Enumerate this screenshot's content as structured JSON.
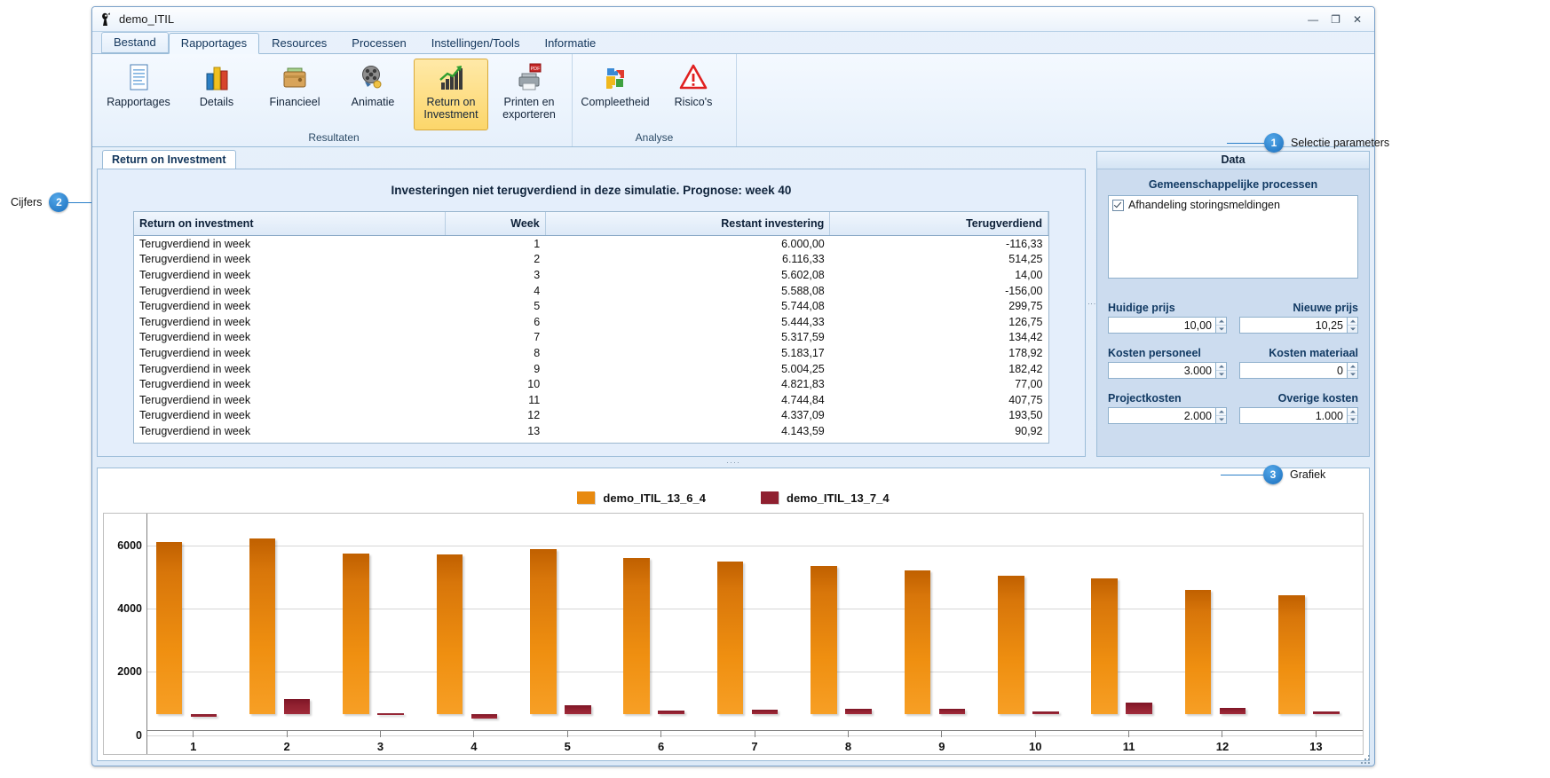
{
  "window": {
    "title": "demo_ITIL",
    "icon": "app-icon",
    "buttons": {
      "minimize": "—",
      "maximize": "❐",
      "close": "✕"
    }
  },
  "ribbon": {
    "tabs": [
      {
        "label": "Bestand",
        "active": false
      },
      {
        "label": "Rapportages",
        "active": true
      },
      {
        "label": "Resources",
        "active": false
      },
      {
        "label": "Processen",
        "active": false
      },
      {
        "label": "Instellingen/Tools",
        "active": false
      },
      {
        "label": "Informatie",
        "active": false
      }
    ],
    "groups": [
      {
        "caption": "Resultaten",
        "items": [
          {
            "label": "Rapportages",
            "icon": "document-icon",
            "selected": false
          },
          {
            "label": "Details",
            "icon": "bar-chart-icon",
            "selected": false
          },
          {
            "label": "Financieel",
            "icon": "wallet-icon",
            "selected": false
          },
          {
            "label": "Animatie",
            "icon": "film-reel-icon",
            "selected": false
          },
          {
            "label": "Return on Investment",
            "icon": "growth-chart-icon",
            "selected": true
          },
          {
            "label": "Printen en exporteren",
            "icon": "printer-pdf-icon",
            "selected": false
          }
        ]
      },
      {
        "caption": "Analyse",
        "items": [
          {
            "label": "Compleetheid",
            "icon": "puzzle-icon",
            "selected": false
          },
          {
            "label": "Risico's",
            "icon": "warning-triangle-icon",
            "selected": false
          }
        ]
      }
    ]
  },
  "report": {
    "tab_label": "Return on Investment",
    "title": "Investeringen niet terugverdiend in deze simulatie. Prognose: week 40",
    "columns": [
      "Return on investment",
      "Week",
      "Restant investering",
      "Terugverdiend"
    ],
    "rows": [
      {
        "label": "Terugverdiend in week",
        "week": "1",
        "restant": "6.000,00",
        "terug": "-116,33"
      },
      {
        "label": "Terugverdiend in week",
        "week": "2",
        "restant": "6.116,33",
        "terug": "514,25"
      },
      {
        "label": "Terugverdiend in week",
        "week": "3",
        "restant": "5.602,08",
        "terug": "14,00"
      },
      {
        "label": "Terugverdiend in week",
        "week": "4",
        "restant": "5.588,08",
        "terug": "-156,00"
      },
      {
        "label": "Terugverdiend in week",
        "week": "5",
        "restant": "5.744,08",
        "terug": "299,75"
      },
      {
        "label": "Terugverdiend in week",
        "week": "6",
        "restant": "5.444,33",
        "terug": "126,75"
      },
      {
        "label": "Terugverdiend in week",
        "week": "7",
        "restant": "5.317,59",
        "terug": "134,42"
      },
      {
        "label": "Terugverdiend in week",
        "week": "8",
        "restant": "5.183,17",
        "terug": "178,92"
      },
      {
        "label": "Terugverdiend in week",
        "week": "9",
        "restant": "5.004,25",
        "terug": "182,42"
      },
      {
        "label": "Terugverdiend in week",
        "week": "10",
        "restant": "4.821,83",
        "terug": "77,00"
      },
      {
        "label": "Terugverdiend in week",
        "week": "11",
        "restant": "4.744,84",
        "terug": "407,75"
      },
      {
        "label": "Terugverdiend in week",
        "week": "12",
        "restant": "4.337,09",
        "terug": "193,50"
      },
      {
        "label": "Terugverdiend in week",
        "week": "13",
        "restant": "4.143,59",
        "terug": "90,92"
      }
    ]
  },
  "data_panel": {
    "header": "Data",
    "processes_caption": "Gemeenschappelijke processen",
    "processes": [
      {
        "label": "Afhandeling storingsmeldingen",
        "checked": true
      }
    ],
    "fields": [
      {
        "label": "Huidige prijs",
        "value": "10,00"
      },
      {
        "label": "Nieuwe prijs",
        "value": "10,25"
      },
      {
        "label": "Kosten personeel",
        "value": "3.000"
      },
      {
        "label": "Kosten materiaal",
        "value": "0"
      },
      {
        "label": "Projectkosten",
        "value": "2.000"
      },
      {
        "label": "Overige kosten",
        "value": "1.000"
      }
    ]
  },
  "chart_data": {
    "type": "bar",
    "title": "",
    "xlabel": "",
    "ylabel": "",
    "ylim": [
      -600,
      7000
    ],
    "yticks": [
      0,
      2000,
      4000,
      6000
    ],
    "grid": true,
    "legend_position": "top-right",
    "categories": [
      "1",
      "2",
      "3",
      "4",
      "5",
      "6",
      "7",
      "8",
      "9",
      "10",
      "11",
      "12",
      "13"
    ],
    "series": [
      {
        "name": "demo_ITIL_13_6_4",
        "color": "#e88a10",
        "values": [
          6000.0,
          6116.33,
          5602.08,
          5588.08,
          5744.08,
          5444.33,
          5317.59,
          5183.17,
          5004.25,
          4821.83,
          4744.84,
          4337.09,
          4143.59
        ]
      },
      {
        "name": "demo_ITIL_13_7_4",
        "color": "#8f2030",
        "values": [
          -116.33,
          514.25,
          14.0,
          -156.0,
          299.75,
          126.75,
          134.42,
          178.92,
          182.42,
          77.0,
          407.75,
          193.5,
          90.92
        ]
      }
    ]
  },
  "callouts": [
    {
      "number": "1",
      "text": "Selectie parameters"
    },
    {
      "number": "2",
      "text": "Cijfers"
    },
    {
      "number": "3",
      "text": "Grafiek"
    }
  ]
}
